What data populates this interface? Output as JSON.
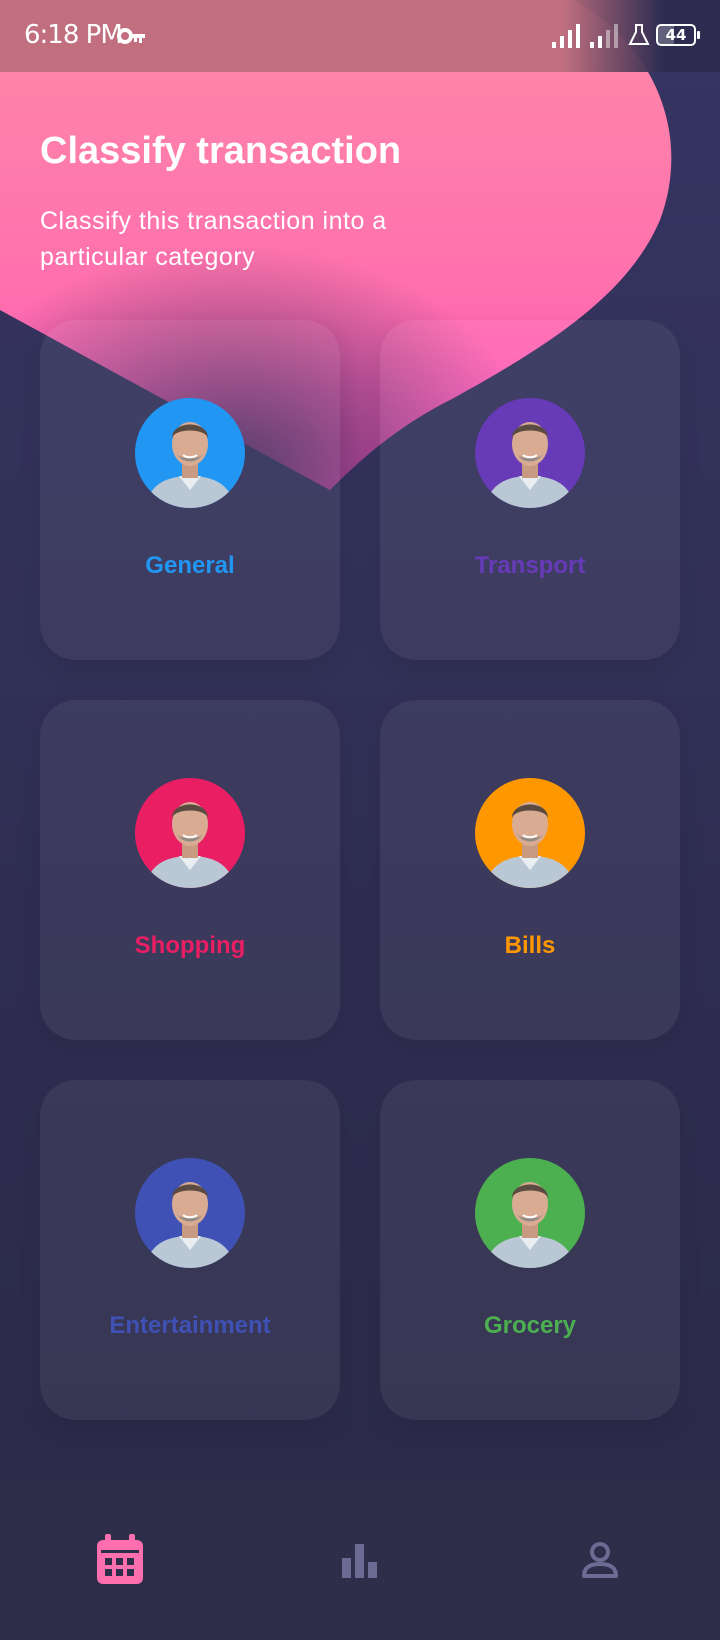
{
  "status": {
    "time": "6:18 PM",
    "battery": "44"
  },
  "header": {
    "title": "Classify transaction",
    "subtitle": "Classify this transaction into a particular category"
  },
  "categories": [
    {
      "label": "General",
      "color": "#2196f3"
    },
    {
      "label": "Transport",
      "color": "#673ab7"
    },
    {
      "label": "Shopping",
      "color": "#e91e63"
    },
    {
      "label": "Bills",
      "color": "#ff9800"
    },
    {
      "label": "Entertainment",
      "color": "#3f51b5"
    },
    {
      "label": "Grocery",
      "color": "#4caf50"
    }
  ],
  "bottom_nav": [
    {
      "icon": "calendar-icon",
      "active": true
    },
    {
      "icon": "bar-chart-icon",
      "active": false
    },
    {
      "icon": "person-icon",
      "active": false
    }
  ],
  "colors": {
    "accent": "#ff6fae",
    "background": "#2f2e52",
    "nav_inactive": "#6b6b93"
  }
}
